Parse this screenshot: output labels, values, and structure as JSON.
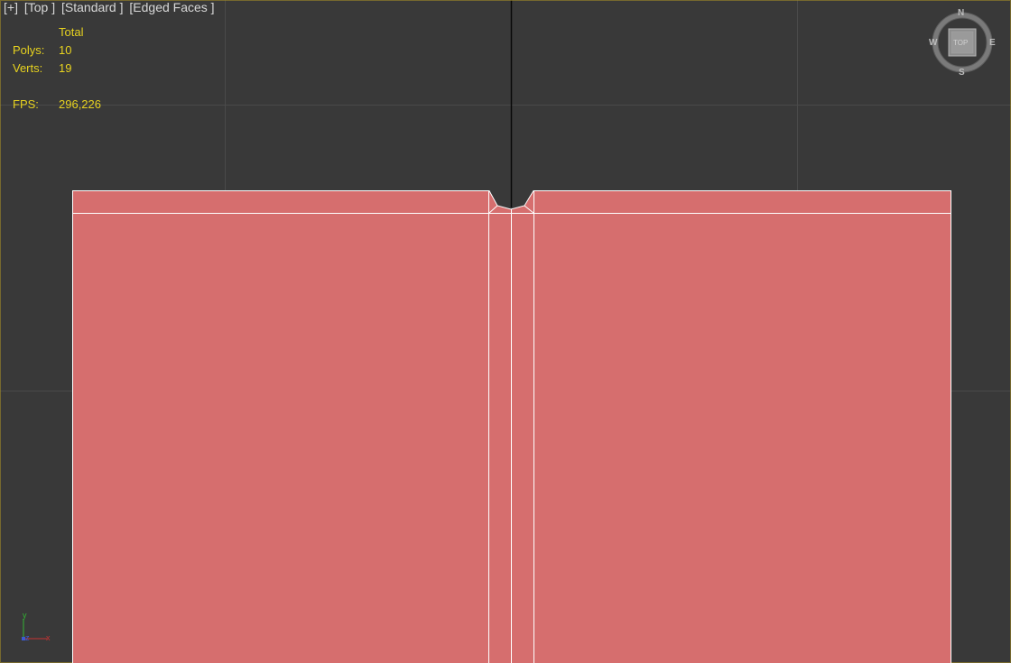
{
  "viewport": {
    "menu": {
      "plus_label": "[+]",
      "view_label": "[Top ]",
      "shading_label": "[Standard ]",
      "display_label": "[Edged Faces ]"
    },
    "stats": {
      "header": "Total",
      "polys_label": "Polys:",
      "polys_value": "10",
      "verts_label": "Verts:",
      "verts_value": "19",
      "fps_label": "FPS:",
      "fps_value": "296,226"
    },
    "viewcube": {
      "north": "N",
      "south": "S",
      "east": "E",
      "west": "W",
      "face": "TOP"
    },
    "axis": {
      "x": "x",
      "y": "y",
      "z": "z"
    }
  },
  "colors": {
    "background": "#393939",
    "grid": "#4a4a4a",
    "mesh_fill": "#d66e6e",
    "mesh_edges": "#ffffff",
    "stats_text": "#e8d31f",
    "menu_text": "#d8d8d8",
    "axis_x": "#c83232",
    "axis_y": "#32b432",
    "axis_z": "#3c5ad2"
  }
}
